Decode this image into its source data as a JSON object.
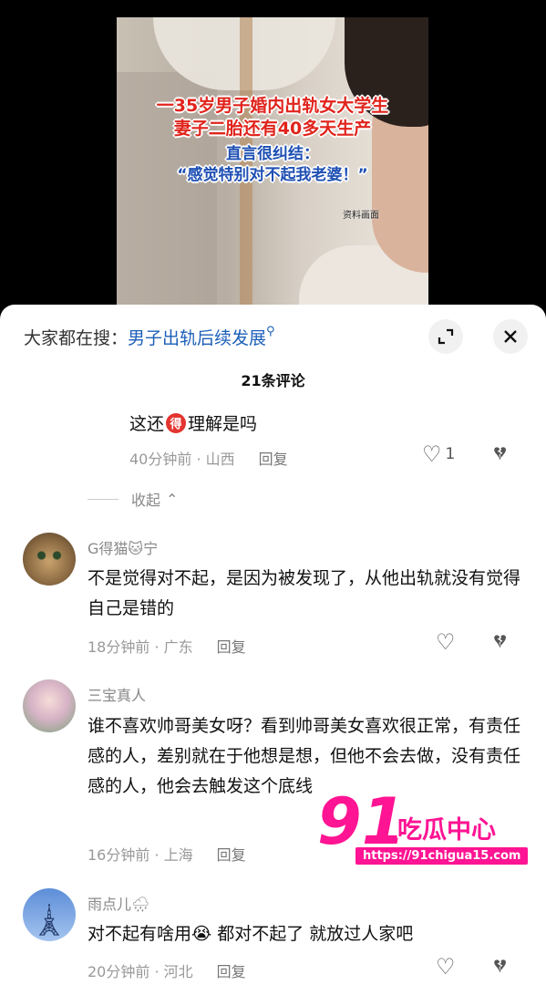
{
  "video": {
    "caption_line1": "一35岁男子婚内出轨女大学生",
    "caption_line2": "妻子二胎还有40多天生产",
    "caption_line3": "直言很纠结：",
    "caption_line4": "“感觉特别对不起我老婆！”",
    "source_label": "资料画面"
  },
  "search": {
    "prefix": "大家都在搜：",
    "term": "男子出轨后续发展",
    "icon": "search-icon"
  },
  "header": {
    "comment_count": "21条评论",
    "expand_icon": "expand-icon",
    "close_icon": "close-icon"
  },
  "reply": {
    "text_before": "这还",
    "badge": "得",
    "text_after": "理解是吗",
    "time": "40分钟前 · 山西",
    "reply_label": "回复",
    "likes": "1"
  },
  "collapse_label": "收起",
  "comments": [
    {
      "username": "G得猫🐱宁",
      "text": "不是觉得对不起，是因为被发现了，从他出轨就没有觉得自己是错的",
      "time": "18分钟前 · 广东",
      "reply_label": "回复"
    },
    {
      "username": "三宝真人",
      "text": "谁不喜欢帅哥美女呀？看到帅哥美女喜欢很正常，有责任感的人，差别就在于他想是想，但他不会去做，没有责任感的人，他会去触发这个底线",
      "time": "16分钟前 · 上海",
      "reply_label": "回复"
    },
    {
      "username": "雨点儿🌧",
      "text": "对不起有啥用😭 都对不起了 就放过人家吧",
      "time": "20分钟前 · 河北",
      "reply_label": "回复"
    }
  ],
  "watermark": {
    "logo_number": "91",
    "logo_text": "吃瓜中心",
    "url": "https://91chigua15.com"
  }
}
